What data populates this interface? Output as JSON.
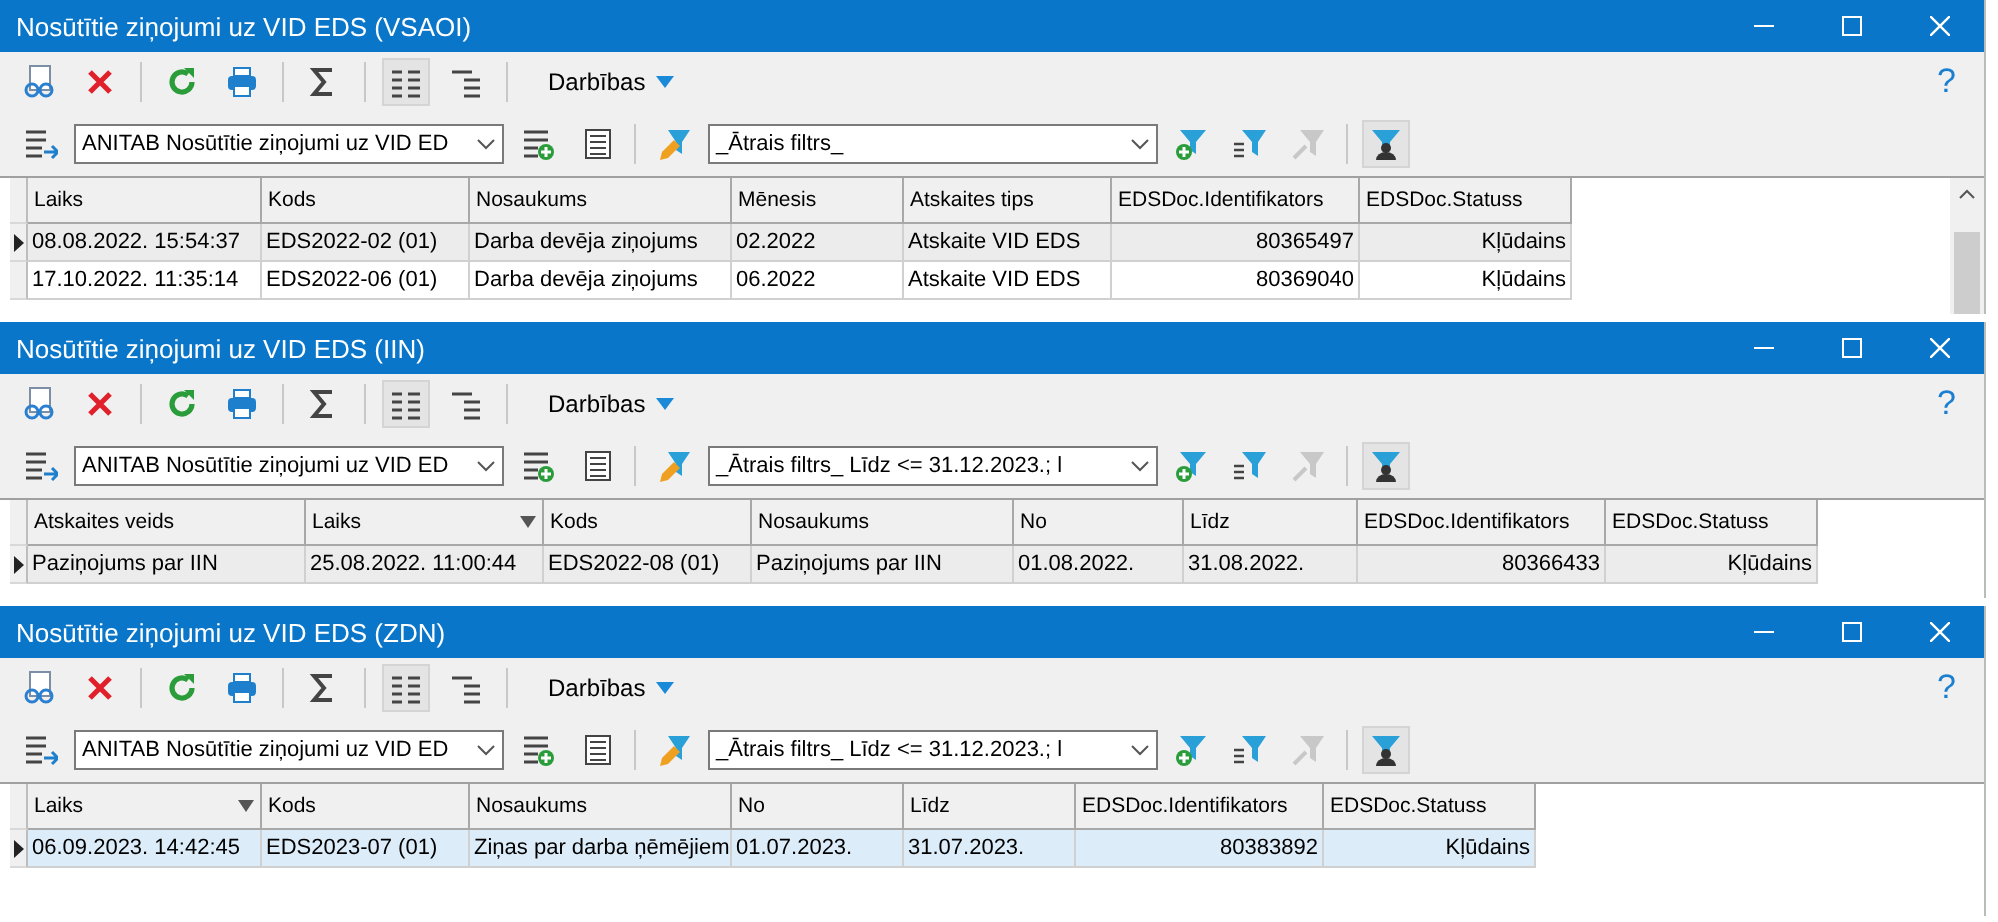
{
  "windows": [
    {
      "title": "Nosūtītie ziņojumi uz VID EDS (VSAOI)",
      "focused": false,
      "actions_label": "Darbības",
      "help": "?",
      "layout_value": "ANITAB Nosūtītie ziņojumi uz VID ED",
      "filter_value": "_Ātrais filtrs_",
      "columns": [
        {
          "label": "Laiks",
          "sorted": false
        },
        {
          "label": "Kods",
          "sorted": false
        },
        {
          "label": "Nosaukums",
          "sorted": false
        },
        {
          "label": "Mēnesis",
          "sorted": false
        },
        {
          "label": "Atskaites tips",
          "sorted": false
        },
        {
          "label": "EDSDoc.Identifikators",
          "sorted": false
        },
        {
          "label": "EDSDoc.Statuss",
          "sorted": false
        }
      ],
      "rows": [
        {
          "selected": true,
          "cells": [
            "08.08.2022. 15:54:37",
            "EDS2022-02 (01)",
            "Darba devēja ziņojums",
            "02.2022",
            "Atskaite VID EDS",
            "80365497",
            "Kļūdains"
          ]
        },
        {
          "selected": false,
          "cells": [
            "17.10.2022. 11:35:14",
            "EDS2022-06 (01)",
            "Darba devēja ziņojums",
            "06.2022",
            "Atskaite VID EDS",
            "80369040",
            "Kļūdains"
          ]
        }
      ]
    },
    {
      "title": "Nosūtītie ziņojumi uz VID EDS (IIN)",
      "focused": false,
      "actions_label": "Darbības",
      "help": "?",
      "layout_value": "ANITAB Nosūtītie ziņojumi uz VID ED",
      "filter_value": "_Ātrais filtrs_ Līdz <= 31.12.2023.; l",
      "columns": [
        {
          "label": "Atskaites veids",
          "sorted": false
        },
        {
          "label": "Laiks",
          "sorted": true
        },
        {
          "label": "Kods",
          "sorted": false
        },
        {
          "label": "Nosaukums",
          "sorted": false
        },
        {
          "label": "No",
          "sorted": false
        },
        {
          "label": "Līdz",
          "sorted": false
        },
        {
          "label": "EDSDoc.Identifikators",
          "sorted": false
        },
        {
          "label": "EDSDoc.Statuss",
          "sorted": false
        }
      ],
      "rows": [
        {
          "selected": true,
          "cells": [
            "Paziņojums par IIN",
            "25.08.2022. 11:00:44",
            "EDS2022-08 (01)",
            "Paziņojums par IIN",
            "01.08.2022.",
            "31.08.2022.",
            "80366433",
            "Kļūdains"
          ]
        }
      ]
    },
    {
      "title": "Nosūtītie ziņojumi uz VID EDS (ZDN)",
      "focused": true,
      "actions_label": "Darbības",
      "help": "?",
      "layout_value": "ANITAB Nosūtītie ziņojumi uz VID ED",
      "filter_value": "_Ātrais filtrs_ Līdz <= 31.12.2023.; l",
      "columns": [
        {
          "label": "Laiks",
          "sorted": true
        },
        {
          "label": "Kods",
          "sorted": false
        },
        {
          "label": "Nosaukums",
          "sorted": false
        },
        {
          "label": "No",
          "sorted": false
        },
        {
          "label": "Līdz",
          "sorted": false
        },
        {
          "label": "EDSDoc.Identifikators",
          "sorted": false
        },
        {
          "label": "EDSDoc.Statuss",
          "sorted": false
        }
      ],
      "rows": [
        {
          "selected": true,
          "cells": [
            "06.09.2023. 14:42:45",
            "EDS2023-07 (01)",
            "Ziņas par darba ņēmējiem",
            "01.07.2023.",
            "31.07.2023.",
            "80383892",
            "Kļūdains"
          ]
        }
      ]
    }
  ]
}
